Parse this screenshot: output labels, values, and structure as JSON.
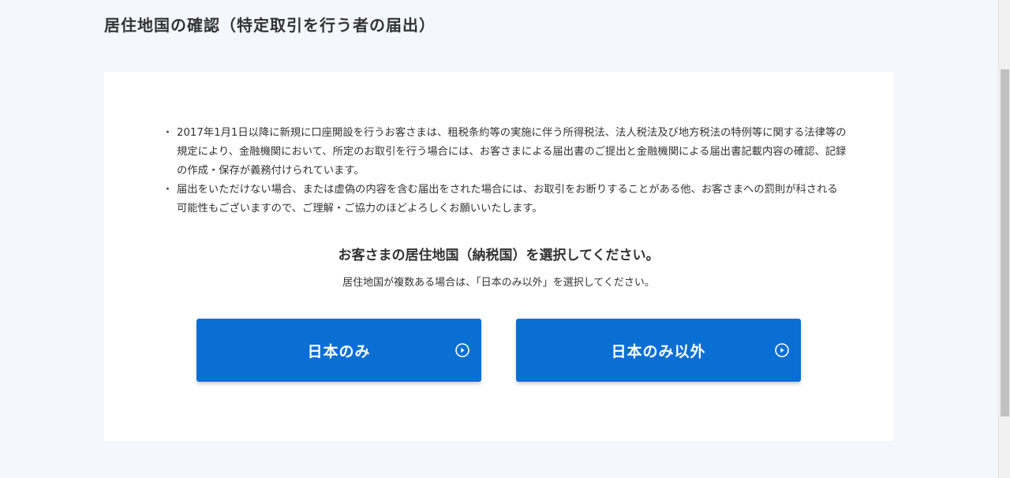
{
  "page": {
    "title": "居住地国の確認（特定取引を行う者の届出）"
  },
  "notice": {
    "bullet": "・",
    "items": [
      "2017年1月1日以降に新規に口座開設を行うお客さまは、租税条約等の実施に伴う所得税法、法人税法及び地方税法の特例等に関する法律等の規定により、金融機関において、所定のお取引を行う場合には、お客さまによる届出書のご提出と金融機関による届出書記載内容の確認、記録の作成・保存が義務付けられています。",
      "届出をいただけない場合、または虚偽の内容を含む届出をされた場合には、お取引をお断りすることがある他、お客さまへの罰則が科される可能性もございますので、ご理解・ご協力のほどよろしくお願いいたします。"
    ]
  },
  "selection": {
    "heading": "お客さまの居住地国（納税国）を選択してください。",
    "note": "居住地国が複数ある場合は、「日本のみ以外」を選択してください。",
    "options": [
      {
        "label": "日本のみ",
        "icon": "play-circle-icon"
      },
      {
        "label": "日本のみ以外",
        "icon": "play-circle-icon"
      }
    ]
  },
  "colors": {
    "background": "#f4f7fb",
    "card": "#ffffff",
    "accent": "#0a6fd3",
    "text": "#333333"
  }
}
